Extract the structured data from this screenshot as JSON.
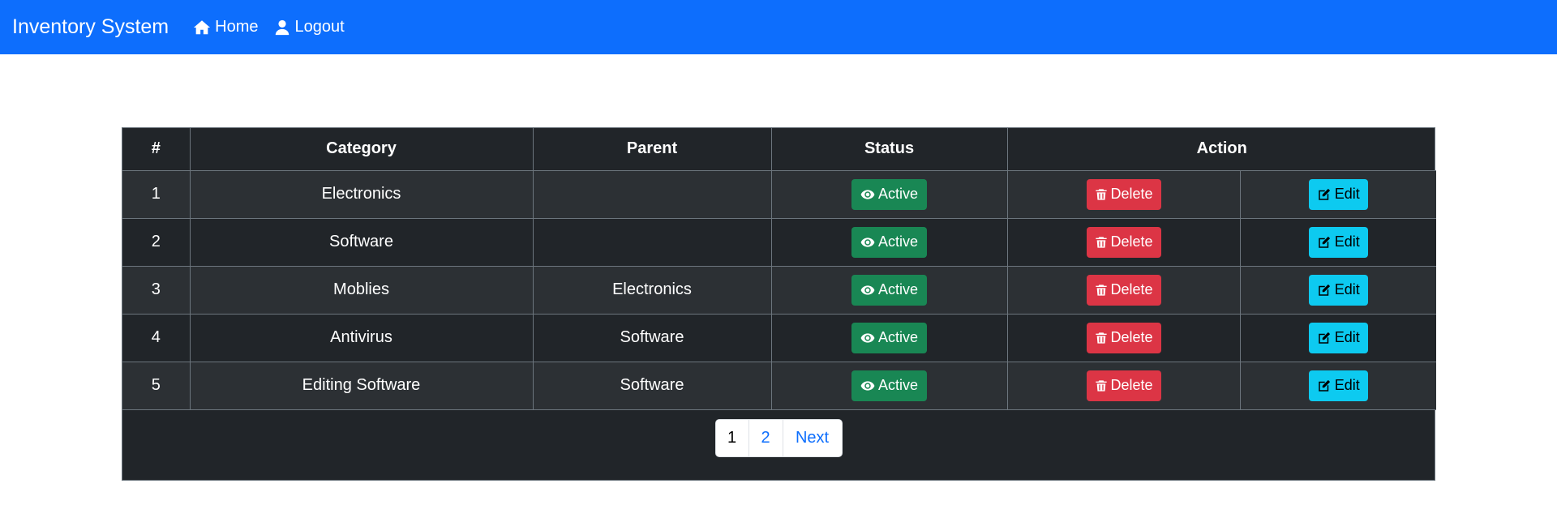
{
  "navbar": {
    "brand": "Inventory System",
    "links": [
      {
        "label": "Home",
        "icon": "home-icon"
      },
      {
        "label": "Logout",
        "icon": "user-icon"
      }
    ]
  },
  "table": {
    "headers": [
      "#",
      "Category",
      "Parent",
      "Status",
      "Action"
    ],
    "rows": [
      {
        "num": "1",
        "category": "Electronics",
        "parent": "",
        "status": "Active",
        "delete": "Delete",
        "edit": "Edit"
      },
      {
        "num": "2",
        "category": "Software",
        "parent": "",
        "status": "Active",
        "delete": "Delete",
        "edit": "Edit"
      },
      {
        "num": "3",
        "category": "Moblies",
        "parent": "Electronics",
        "status": "Active",
        "delete": "Delete",
        "edit": "Edit"
      },
      {
        "num": "4",
        "category": "Antivirus",
        "parent": "Software",
        "status": "Active",
        "delete": "Delete",
        "edit": "Edit"
      },
      {
        "num": "5",
        "category": "Editing Software",
        "parent": "Software",
        "status": "Active",
        "delete": "Delete",
        "edit": "Edit"
      }
    ]
  },
  "pagination": {
    "pages": [
      "1",
      "2"
    ],
    "current": "1",
    "next": "Next"
  },
  "colors": {
    "navbar": "#0d6efd",
    "table_dark": "#212529",
    "active": "#198754",
    "delete": "#dc3545",
    "edit": "#0dcaf0"
  }
}
